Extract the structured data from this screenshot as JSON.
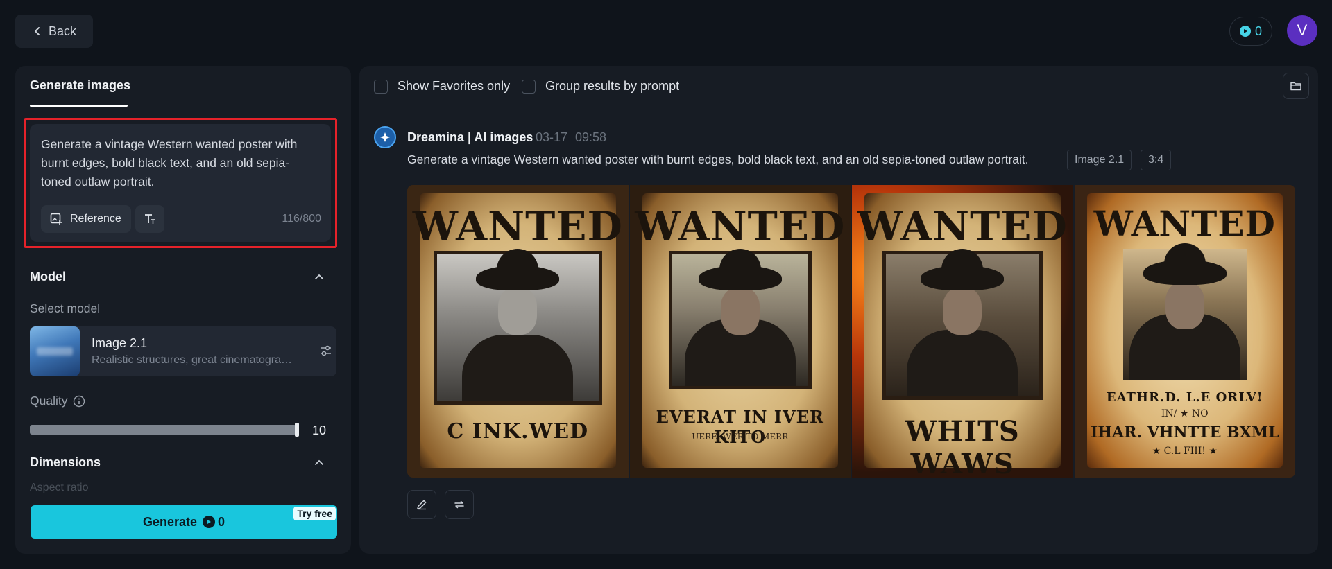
{
  "topbar": {
    "back_label": "Back",
    "credits": "0",
    "avatar_initial": "V",
    "accent": "#46d3e6",
    "avatar_color": "#5b2fc0"
  },
  "left": {
    "tab_label": "Generate images",
    "prompt_text": "Generate a vintage Western wanted poster with burnt edges, bold black text, and an old sepia-toned outlaw portrait.",
    "reference_label": "Reference",
    "char_count": "116/800",
    "model_section": "Model",
    "select_model_label": "Select model",
    "model_name": "Image 2.1",
    "model_desc": "Realistic structures, great cinematography",
    "quality_label": "Quality",
    "quality_value": "10",
    "quality_fraction": 1.0,
    "dimensions_section": "Dimensions",
    "aspect_ratio_label": "Aspect ratio",
    "generate_label": "Generate",
    "generate_cost": "0",
    "try_free_label": "Try free",
    "generate_color": "#19c6dd",
    "highlight_color": "#e5222a"
  },
  "right": {
    "show_favorites_label": "Show Favorites only",
    "group_results_label": "Group results by prompt",
    "source_name": "Dreamina | AI images",
    "date": "03-17",
    "time": "09:58",
    "prompt": "Generate a vintage Western wanted poster with burnt edges, bold black text, and an old sepia-toned outlaw portrait.",
    "model_tag": "Image 2.1",
    "ratio_tag": "3:4",
    "images": [
      {
        "title": "WANTED",
        "line1": "C INK.WED",
        "line2": ""
      },
      {
        "title": "WANTED",
        "line1": "EVERAT IN IVER KITO",
        "line2": "UERE, WER TO MERR"
      },
      {
        "title": "WANTED",
        "line1": "WHITS WAWS",
        "line2": ""
      },
      {
        "title": "WANTED",
        "line1": "EATHR.D. L.E ORLV!",
        "line2": "IN/ ★ NO",
        "line3": "IHAR. VHNTTE BXML",
        "line4": "★ C.L FIII! ★"
      }
    ]
  }
}
